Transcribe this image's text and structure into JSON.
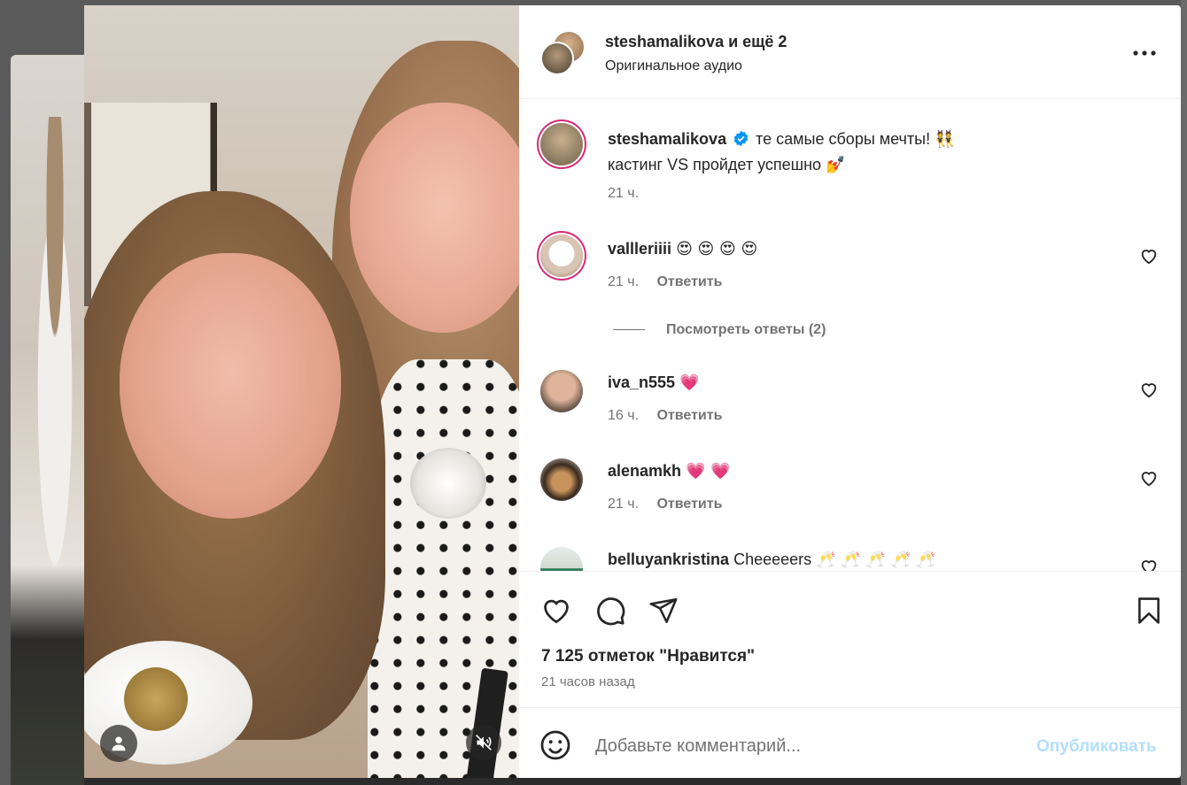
{
  "header": {
    "username": "steshamalikova",
    "others": "и ещё 2",
    "audio": "Оригинальное аудио"
  },
  "caption": {
    "username": "steshamalikova",
    "text_line1": "те самые сборы мечты!",
    "text_line1_emoji": "👯",
    "text_line2": "кастинг VS пройдет успешно",
    "text_line2_emoji": "💅",
    "time": "21 ч."
  },
  "comments": [
    {
      "username": "vallleriiii",
      "text": "",
      "emoji": "😍 😍 😍 😍",
      "time": "21 ч.",
      "reply": "Ответить"
    },
    {
      "username": "iva_n555",
      "text": "",
      "emoji": "💗",
      "time": "16 ч.",
      "reply": "Ответить"
    },
    {
      "username": "alenamkh",
      "text": "",
      "emoji": "💗 💗",
      "time": "21 ч.",
      "reply": "Ответить"
    },
    {
      "username": "belluyankristina",
      "text": "Cheeeeers",
      "emoji": "🥂 🥂 🥂 🥂 🥂",
      "time": "",
      "reply": ""
    }
  ],
  "view_replies": "Посмотреть ответы (2)",
  "likes": "7 125 отметок \"Нравится\"",
  "time_ago": "21 часов назад",
  "composer": {
    "placeholder": "Добавьте комментарий...",
    "post_label": "Опубликовать"
  },
  "colors": {
    "text": "#262626",
    "secondary": "#737373",
    "post_disabled": "#b2dffc",
    "verified": "#0095f6",
    "story_ring": "#d62976"
  },
  "icons": [
    "user-icon",
    "muted-icon",
    "more-icon",
    "verified-icon",
    "heart-icon",
    "comment-icon",
    "share-icon",
    "bookmark-icon",
    "emoji-icon"
  ]
}
